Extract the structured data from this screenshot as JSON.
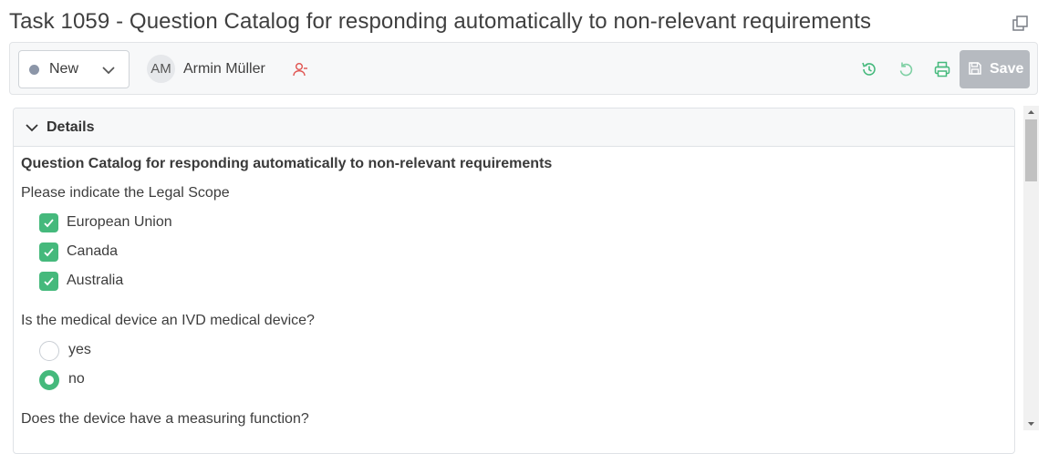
{
  "page": {
    "title": "Task 1059 - Question Catalog for responding automatically to non-relevant requirements"
  },
  "toolbar": {
    "status_label": "New",
    "avatar_initials": "AM",
    "assignee_name": "Armin Müller",
    "save_label": "Save",
    "colors": {
      "accent_green": "#45b97c",
      "unassign_red": "#e0524f",
      "save_disabled": "#b6bac0"
    }
  },
  "panel": {
    "header": "Details",
    "catalog_title": "Question Catalog for responding automatically to non-relevant requirements",
    "questions": [
      {
        "text": "Please indicate the Legal Scope",
        "type": "checkbox",
        "options": [
          {
            "label": "European Union",
            "checked": true
          },
          {
            "label": "Canada",
            "checked": true
          },
          {
            "label": "Australia",
            "checked": true
          }
        ]
      },
      {
        "text": "Is the medical device an IVD medical device?",
        "type": "radio",
        "options": [
          {
            "label": "yes",
            "selected": false
          },
          {
            "label": "no",
            "selected": true
          }
        ]
      },
      {
        "text": "Does the device have a measuring function?",
        "type": "radio",
        "options": []
      }
    ]
  },
  "icons": {
    "popout": "popout-icon",
    "chevron": "chevron-down-icon",
    "unassign": "user-remove-icon",
    "history": "history-icon",
    "undo": "undo-icon",
    "print": "print-icon",
    "save": "save-icon"
  }
}
